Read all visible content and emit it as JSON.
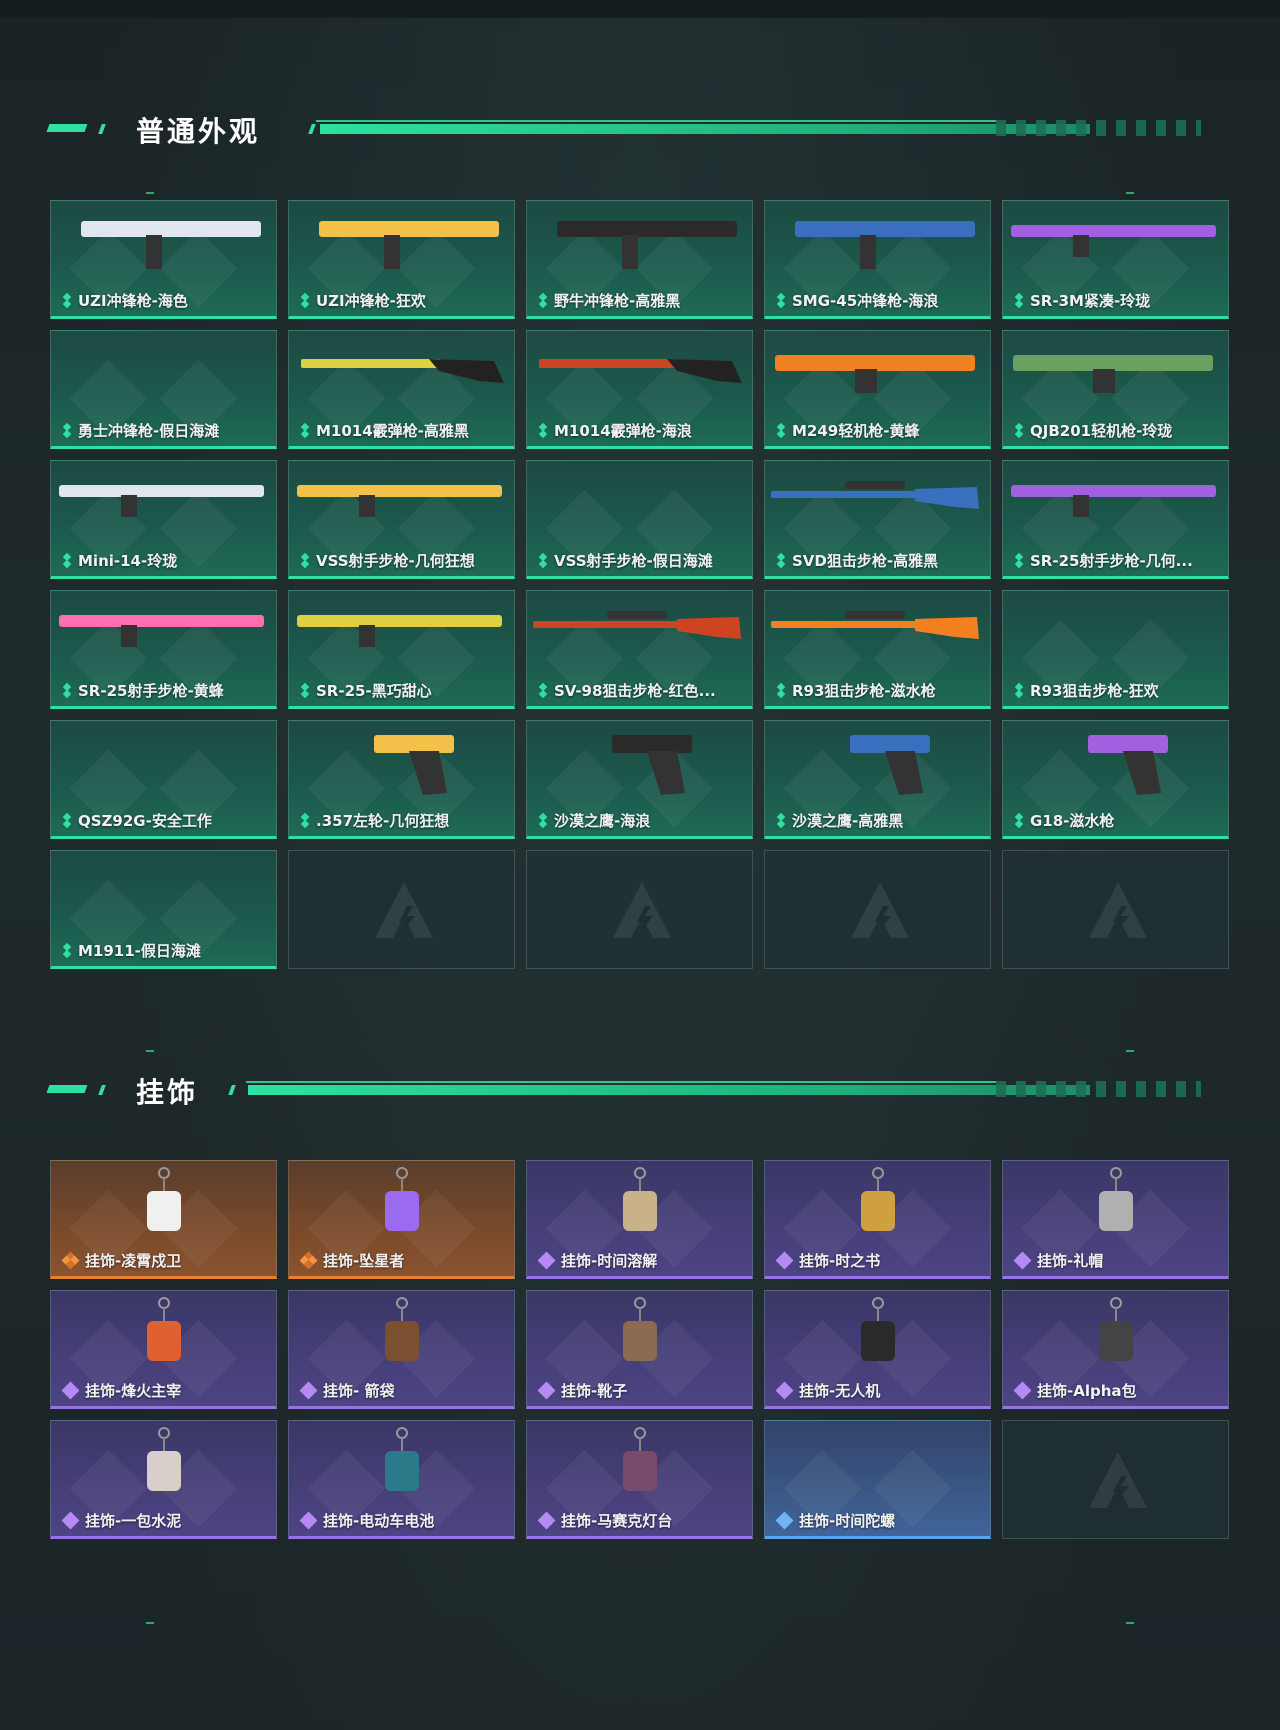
{
  "sections": {
    "skins_title": "普通外观",
    "charms_title": "挂饰"
  },
  "colors": {
    "accent_green": "#2fe0a0",
    "rarity_purple": "#9a72e6",
    "rarity_orange": "#e8812c",
    "rarity_blue": "#5aa3e8"
  },
  "skins": [
    {
      "label": "UZI冲锋枪-海色",
      "icon": "smg-icon",
      "rarity": "green"
    },
    {
      "label": "UZI冲锋枪-狂欢",
      "icon": "smg-icon",
      "rarity": "green"
    },
    {
      "label": "野牛冲锋枪-高雅黑",
      "icon": "smg-icon",
      "rarity": "green"
    },
    {
      "label": "SMG-45冲锋枪-海浪",
      "icon": "smg-icon",
      "rarity": "green"
    },
    {
      "label": "SR-3M紧凑-玲珑",
      "icon": "rifle-icon",
      "rarity": "green"
    },
    {
      "label": "勇士冲锋枪-假日海滩",
      "icon": "none",
      "rarity": "green"
    },
    {
      "label": "M1014霰弹枪-高雅黑",
      "icon": "shotgun-icon",
      "rarity": "green"
    },
    {
      "label": "M1014霰弹枪-海浪",
      "icon": "shotgun-icon",
      "rarity": "green"
    },
    {
      "label": "M249轻机枪-黄蜂",
      "icon": "lmg-icon",
      "rarity": "green"
    },
    {
      "label": "QJB201轻机枪-玲珑",
      "icon": "lmg-icon",
      "rarity": "green"
    },
    {
      "label": "Mini-14-玲珑",
      "icon": "rifle-icon",
      "rarity": "green"
    },
    {
      "label": "VSS射手步枪-几何狂想",
      "icon": "rifle-icon",
      "rarity": "green"
    },
    {
      "label": "VSS射手步枪-假日海滩",
      "icon": "none",
      "rarity": "green"
    },
    {
      "label": "SVD狙击步枪-高雅黑",
      "icon": "sniper-icon",
      "rarity": "green"
    },
    {
      "label": "SR-25射手步枪-几何...",
      "icon": "rifle-icon",
      "rarity": "green"
    },
    {
      "label": "SR-25射手步枪-黄蜂",
      "icon": "rifle-icon",
      "rarity": "green"
    },
    {
      "label": "SR-25-黑巧甜心",
      "icon": "rifle-icon",
      "rarity": "green"
    },
    {
      "label": "SV-98狙击步枪-红色...",
      "icon": "sniper-icon",
      "rarity": "green"
    },
    {
      "label": "R93狙击步枪-滋水枪",
      "icon": "sniper-icon",
      "rarity": "green"
    },
    {
      "label": "R93狙击步枪-狂欢",
      "icon": "none",
      "rarity": "green"
    },
    {
      "label": "QSZ92G-安全工作",
      "icon": "none",
      "rarity": "green"
    },
    {
      "label": ".357左轮-几何狂想",
      "icon": "revolver-icon",
      "rarity": "green"
    },
    {
      "label": "沙漠之鹰-海浪",
      "icon": "pistol-icon",
      "rarity": "green"
    },
    {
      "label": "沙漠之鹰-高雅黑",
      "icon": "pistol-icon",
      "rarity": "green"
    },
    {
      "label": "G18-滋水枪",
      "icon": "pistol-icon",
      "rarity": "green"
    },
    {
      "label": "M1911-假日海滩",
      "icon": "none",
      "rarity": "green"
    }
  ],
  "charms": [
    {
      "label": "挂饰-凌霄戍卫",
      "icon": "charm-icon",
      "rarity": "orange"
    },
    {
      "label": "挂饰-坠星者",
      "icon": "charm-icon",
      "rarity": "orange"
    },
    {
      "label": "挂饰-时间溶解",
      "icon": "charm-icon",
      "rarity": "purple"
    },
    {
      "label": "挂饰-时之书",
      "icon": "charm-icon",
      "rarity": "purple"
    },
    {
      "label": "挂饰-礼帽",
      "icon": "charm-icon",
      "rarity": "purple"
    },
    {
      "label": "挂饰-烽火主宰",
      "icon": "charm-icon",
      "rarity": "purple"
    },
    {
      "label": "挂饰- 箭袋",
      "icon": "charm-icon",
      "rarity": "purple"
    },
    {
      "label": "挂饰-靴子",
      "icon": "charm-icon",
      "rarity": "purple"
    },
    {
      "label": "挂饰-无人机",
      "icon": "charm-icon",
      "rarity": "purple"
    },
    {
      "label": "挂饰-Alpha包",
      "icon": "charm-icon",
      "rarity": "purple"
    },
    {
      "label": "挂饰-一包水泥",
      "icon": "charm-icon",
      "rarity": "purple"
    },
    {
      "label": "挂饰-电动车电池",
      "icon": "charm-icon",
      "rarity": "purple"
    },
    {
      "label": "挂饰-马赛克灯台",
      "icon": "charm-icon",
      "rarity": "purple"
    },
    {
      "label": "挂饰-时间陀螺",
      "icon": "none",
      "rarity": "blue"
    }
  ]
}
